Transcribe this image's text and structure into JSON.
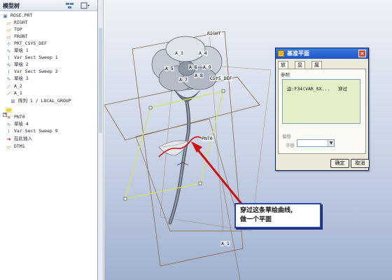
{
  "model_tree": {
    "title": "模型树",
    "header_buttons": [
      "tree-settings",
      "show-options"
    ],
    "items": [
      {
        "label": "ROSE.PRT",
        "icon": "part-icon"
      },
      {
        "label": "RIGHT",
        "icon": "datum-plane-icon"
      },
      {
        "label": "TOP",
        "icon": "datum-plane-icon"
      },
      {
        "label": "FRONT",
        "icon": "datum-plane-icon"
      },
      {
        "label": "PRT_CSYS_DEF",
        "icon": "coordinate-system-icon"
      },
      {
        "label": "草绘 1",
        "icon": "sketch-icon"
      },
      {
        "label": "Var Sect Sweep 1",
        "icon": "sweep-icon"
      },
      {
        "label": "草绘 2",
        "icon": "sketch-icon"
      },
      {
        "label": "Var Sect Sweep 2",
        "icon": "sweep-icon"
      },
      {
        "label": "草绘 3",
        "icon": "sketch-icon"
      },
      {
        "label": "A_2",
        "icon": "datum-axis-icon"
      },
      {
        "label": "A_1",
        "icon": "datum-axis-icon"
      },
      {
        "label": "阵列 1 / LOCAL_GROUP",
        "icon": "pattern-icon"
      },
      {
        "label": "",
        "icon": "datum-plane-icon"
      },
      {
        "label": "PNT0",
        "icon": "datum-point-icon"
      },
      {
        "label": "草绘 4",
        "icon": "sketch-icon"
      },
      {
        "label": "Var Sect Sweep 9",
        "icon": "sweep-icon"
      },
      {
        "label": "在此插入",
        "icon": "insert-here-icon"
      },
      {
        "label": "DTM1",
        "icon": "datum-plane-icon"
      }
    ]
  },
  "viewport": {
    "labels": {
      "right": "RIGHT",
      "a5": "A_5",
      "a3": "A_3",
      "a4": "A_4",
      "a6": "A_6",
      "a7": "A_7",
      "a8": "A_8",
      "a9": "A_9",
      "csys": "CSYS_DEF",
      "pnt0": "PNT0",
      "a1": "A_1"
    },
    "callout": {
      "line1": "穿过这条草绘曲线,",
      "line2": "做一个平面"
    }
  },
  "dialog": {
    "title": "基准平面",
    "tabs": [
      "放置",
      "显示",
      "属性"
    ],
    "active_tab": "放置",
    "references_label": "参照",
    "reference_item": "边:F34(VAR_SX...",
    "reference_constraint": "穿过",
    "offset_label": "偏移",
    "translation_label": "平移",
    "offset_value": "",
    "ok_label": "确定",
    "cancel_label": "取消"
  },
  "colors": {
    "dialog_titlebar": "#1c54c8",
    "references_bg": "#e5f0c8",
    "annotation_red": "#d01010",
    "datum_plane_edge": "#8a6a40",
    "highlight_plane": "#d7e35a",
    "callout_border": "#2a45a8"
  }
}
